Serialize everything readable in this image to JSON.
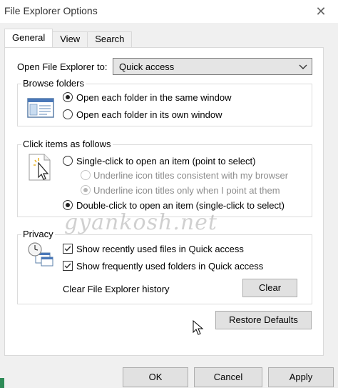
{
  "window": {
    "title": "File Explorer Options",
    "close_glyph": "✕"
  },
  "tabs": [
    {
      "label": "General",
      "active": true
    },
    {
      "label": "View",
      "active": false
    },
    {
      "label": "Search",
      "active": false
    }
  ],
  "open_to": {
    "label": "Open File Explorer to:",
    "value": "Quick access"
  },
  "browse_folders": {
    "title": "Browse folders",
    "options": [
      {
        "label": "Open each folder in the same window",
        "checked": true
      },
      {
        "label": "Open each folder in its own window",
        "checked": false
      }
    ]
  },
  "click_items": {
    "title": "Click items as follows",
    "single_click": "Single-click to open an item (point to select)",
    "underline_browser": "Underline icon titles consistent with my browser",
    "underline_point": "Underline icon titles only when I point at them",
    "double_click": "Double-click to open an item (single-click to select)"
  },
  "privacy": {
    "title": "Privacy",
    "recent_files": "Show recently used files in Quick access",
    "frequent_folders": "Show frequently used folders in Quick access",
    "clear_label": "Clear File Explorer history",
    "clear_button": "Clear"
  },
  "restore_defaults": "Restore Defaults",
  "footer": {
    "ok": "OK",
    "cancel": "Cancel",
    "apply": "Apply"
  },
  "watermark": "gyankosh.net",
  "colors": {
    "dialog_bg": "#f0f0f0",
    "panel_bg": "#ffffff",
    "button_bg": "#e1e1e1"
  }
}
